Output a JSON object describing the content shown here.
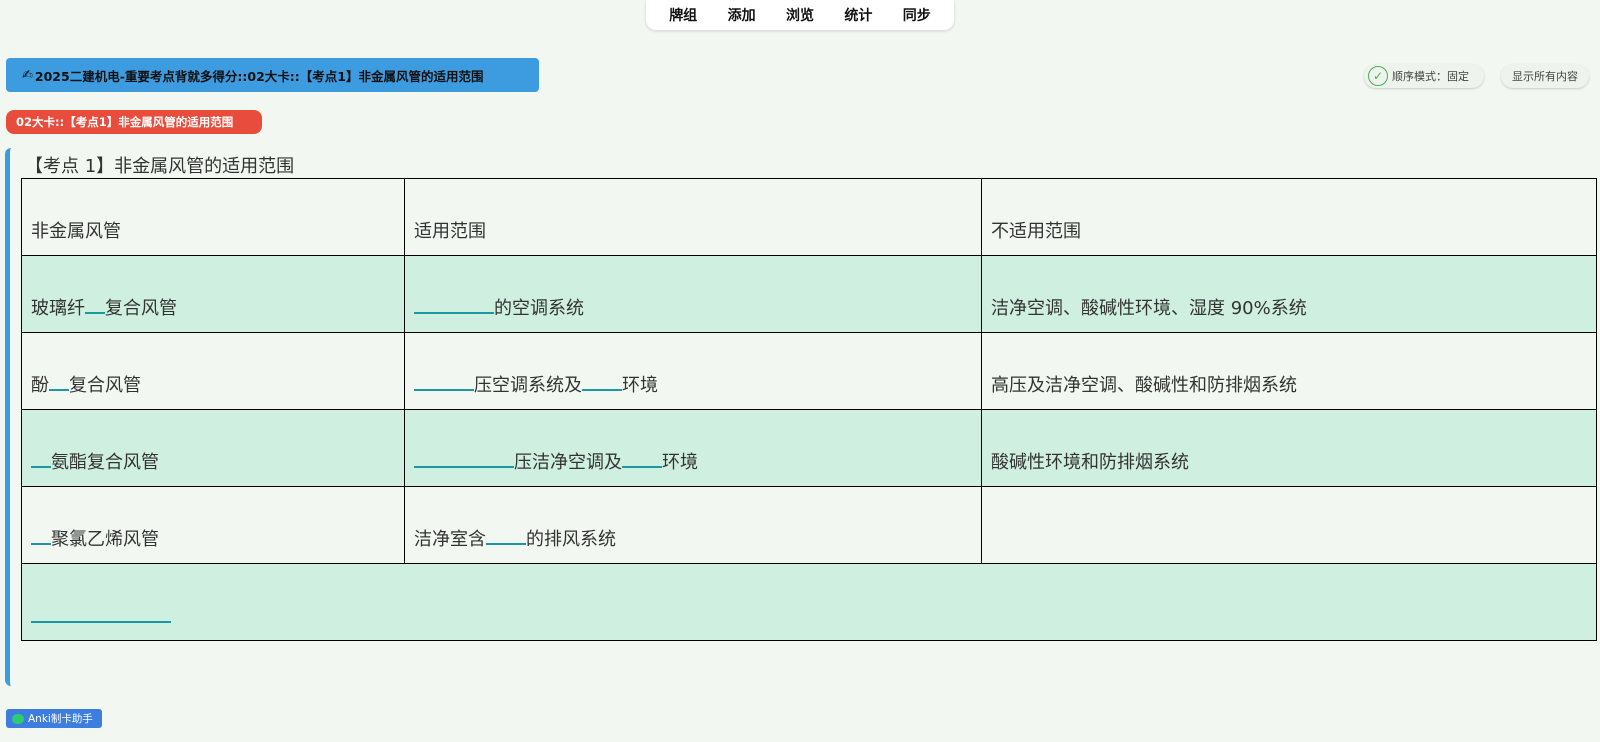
{
  "menu": {
    "items": [
      "牌组",
      "添加",
      "浏览",
      "统计",
      "同步"
    ]
  },
  "deck_banner": {
    "icon": "pen-icon",
    "text": "2025二建机电-重要考点背就多得分::02大卡::【考点1】非金属风管的适用范围"
  },
  "controls": {
    "mode_label": "顺序模式：固定",
    "show_all_label": "显示所有内容"
  },
  "sub_tag": "02大卡::【考点1】非金属风管的适用范围",
  "card": {
    "title": "【考点 1】非金属风管的适用范围",
    "header": [
      "非金属风管",
      "适用范围",
      "不适用范围"
    ],
    "rows": [
      {
        "c1": [
          "玻璃纤",
          "复合风管"
        ],
        "c2": [
          "",
          "的空调系统"
        ],
        "c3": "洁净空调、酸碱性环境、湿度 90%系统"
      },
      {
        "c1": [
          "酚",
          "复合风管"
        ],
        "c2": [
          "",
          "压空调系统及",
          "环境"
        ],
        "c3": "高压及洁净空调、酸碱性和防排烟系统"
      },
      {
        "c1": [
          "",
          "氨酯复合风管"
        ],
        "c2": [
          "",
          "压洁净空调及",
          "环境"
        ],
        "c3": "酸碱性环境和防排烟系统"
      },
      {
        "c1": [
          "",
          "聚氯乙烯风管"
        ],
        "c2": [
          "洁净室含",
          "的排风系统"
        ],
        "c3": ""
      }
    ]
  },
  "helper_badge": "Anki制卡助手",
  "colors": {
    "banner_blue": "#3d9be0",
    "tag_red": "#e74c3c",
    "row_band": "#cff0e1",
    "blank_underline": "#1a9aa0",
    "background": "#f2f8f1"
  }
}
